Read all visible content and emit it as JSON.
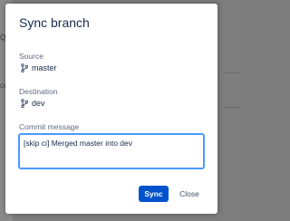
{
  "background": {
    "left_glyphs": [
      "Q",
      "ON"
    ]
  },
  "dialog": {
    "title": "Sync branch",
    "source": {
      "label": "Source",
      "branch": "master",
      "icon": "branch-icon"
    },
    "destination": {
      "label": "Destination",
      "branch": "dev",
      "icon": "branch-icon"
    },
    "commit_message": {
      "label": "Commit message",
      "value": "[skip ci] Merged master into dev"
    },
    "buttons": {
      "sync": "Sync",
      "close": "Close"
    }
  },
  "colors": {
    "primary": "#0052cc",
    "focus_border": "#4c9aff",
    "heading": "#172b4d",
    "label": "#5e6c84"
  }
}
